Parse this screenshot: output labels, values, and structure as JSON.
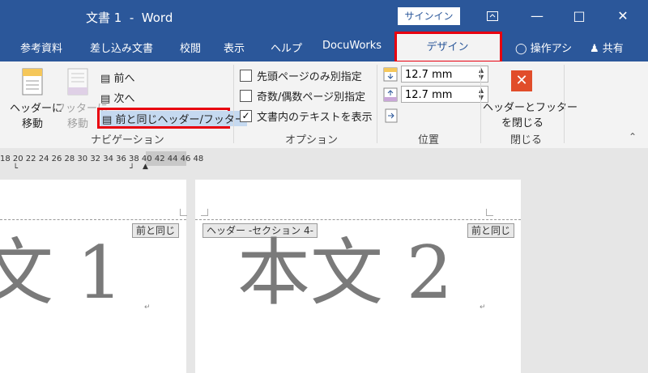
{
  "window": {
    "title": "文書 1  -  Word",
    "signin": "サインイン"
  },
  "tabs": [
    "参考資料",
    "差し込み文書",
    "校閲",
    "表示",
    "ヘルプ",
    "DocuWorks",
    "デザイン",
    "操作アシ",
    "共有"
  ],
  "ribbon": {
    "navigation": {
      "goto_header": [
        "ヘッダーに",
        "移動"
      ],
      "goto_footer": [
        "フッターに",
        "移動"
      ],
      "previous": "前へ",
      "next": "次へ",
      "link_to_previous": "前と同じヘッダー/フッター",
      "group_label": "ナビゲーション"
    },
    "options": {
      "first_page": "先頭ページのみ別指定",
      "odd_even": "奇数/偶数ページ別指定",
      "show_text": "文書内のテキストを表示",
      "group_label": "オプション"
    },
    "position": {
      "header_pos": "12.7 mm",
      "footer_pos": "12.7 mm",
      "group_label": "位置"
    },
    "close": {
      "close_label": [
        "ヘッダーとフッター",
        "を閉じる"
      ],
      "group_label": "閉じる"
    }
  },
  "ruler": "18 20 22 24 26 28 30 32 34 36 38 40 42 44 46 48",
  "document": {
    "left_page": {
      "tag": "前と同じ",
      "body": "文 1"
    },
    "right_page": {
      "header_tag": "ヘッダー -セクション 4-",
      "tag": "前と同じ",
      "body": "本文 2"
    }
  },
  "colors": {
    "accent": "#2b579a",
    "highlight": "#e8000f"
  }
}
